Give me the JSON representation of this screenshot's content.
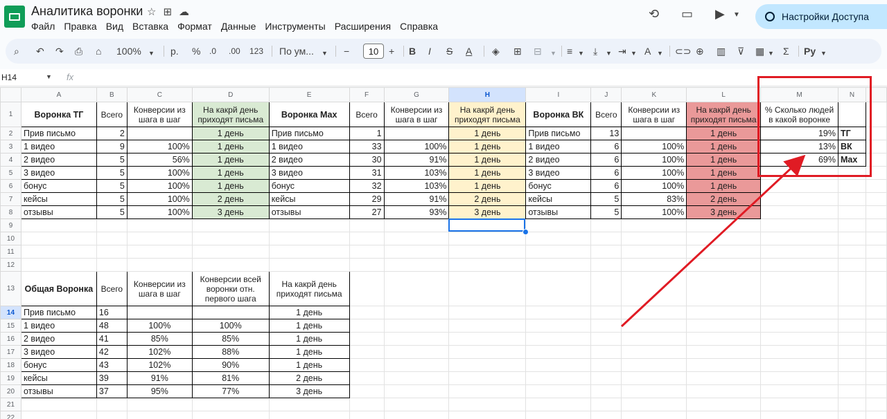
{
  "app": {
    "title": "Аналитика воронки",
    "menu": [
      "Файл",
      "Правка",
      "Вид",
      "Вставка",
      "Формат",
      "Данные",
      "Инструменты",
      "Расширения",
      "Справка"
    ],
    "share_label": "Настройки Доступа"
  },
  "toolbar": {
    "zoom": "100%",
    "currency": "р.",
    "percent": "%",
    "dec_minus": ".0",
    "dec_plus": ".00",
    "num_format": "123",
    "font": "По ум...",
    "font_size": "10"
  },
  "formula_bar": {
    "cell_ref": "H14",
    "fx": "fx",
    "value": ""
  },
  "sheet": {
    "columns": [
      "A",
      "B",
      "C",
      "D",
      "E",
      "F",
      "G",
      "H",
      "I",
      "J",
      "K",
      "L",
      "M",
      "N"
    ],
    "rows": [
      [
        "Воронка ТГ",
        "Всего",
        "Конверсии из шага в шаг",
        "На какрй день приходят письма",
        "Воронка Мах",
        "Всего",
        "Конверсии из шага в шаг",
        "На какрй день приходят письма",
        "Воронка ВК",
        "Всего",
        "Конверсии из шага в шаг",
        "На какрй день приходят письма",
        "% Сколько людей в какой воронке",
        ""
      ],
      [
        "Прив письмо",
        "2",
        "",
        "1 день",
        "Прив письмо",
        "1",
        "",
        "1 день",
        "Прив письмо",
        "13",
        "",
        "1 день",
        "19%",
        "ТГ"
      ],
      [
        "1 видео",
        "9",
        "100%",
        "1 день",
        "1 видео",
        "33",
        "100%",
        "1 день",
        "1 видео",
        "6",
        "100%",
        "1 день",
        "13%",
        "ВК"
      ],
      [
        "2 видео",
        "5",
        "56%",
        "1 день",
        "2 видео",
        "30",
        "91%",
        "1 день",
        "2 видео",
        "6",
        "100%",
        "1 день",
        "69%",
        "Max"
      ],
      [
        "3 видео",
        "5",
        "100%",
        "1 день",
        "3 видео",
        "31",
        "103%",
        "1 день",
        "3 видео",
        "6",
        "100%",
        "1 день",
        "",
        ""
      ],
      [
        "бонус",
        "5",
        "100%",
        "1 день",
        "бонус",
        "32",
        "103%",
        "1 день",
        "бонус",
        "6",
        "100%",
        "1 день",
        "",
        ""
      ],
      [
        "кейсы",
        "5",
        "100%",
        "2 день",
        "кейсы",
        "29",
        "91%",
        "2 день",
        "кейсы",
        "5",
        "83%",
        "2 день",
        "",
        ""
      ],
      [
        "отзывы",
        "5",
        "100%",
        "3 день",
        "отзывы",
        "27",
        "93%",
        "3 день",
        "отзывы",
        "5",
        "100%",
        "3 день",
        "",
        ""
      ],
      [
        "",
        "",
        "",
        "",
        "",
        "",
        "",
        "",
        "",
        "",
        "",
        "",
        "",
        ""
      ],
      [
        "",
        "",
        "",
        "",
        "",
        "",
        "",
        "",
        "",
        "",
        "",
        "",
        "",
        ""
      ],
      [
        "",
        "",
        "",
        "",
        "",
        "",
        "",
        "",
        "",
        "",
        "",
        "",
        "",
        ""
      ],
      [
        "",
        "",
        "",
        "",
        "",
        "",
        "",
        "",
        "",
        "",
        "",
        "",
        "",
        ""
      ],
      [
        "Общая Воронка",
        "Всего",
        "Конверсии из шага в шаг",
        "Конверсии всей воронки отн. первого шага",
        "На какрй день приходят письма",
        "",
        "",
        "",
        "",
        "",
        "",
        "",
        "",
        ""
      ],
      [
        "Прив письмо",
        "16",
        "",
        "",
        "1 день",
        "",
        "",
        "",
        "",
        "",
        "",
        "",
        "",
        ""
      ],
      [
        "1 видео",
        "48",
        "100%",
        "100%",
        "1 день",
        "",
        "",
        "",
        "",
        "",
        "",
        "",
        "",
        ""
      ],
      [
        "2 видео",
        "41",
        "85%",
        "85%",
        "1 день",
        "",
        "",
        "",
        "",
        "",
        "",
        "",
        "",
        ""
      ],
      [
        "3 видео",
        "42",
        "102%",
        "88%",
        "1 день",
        "",
        "",
        "",
        "",
        "",
        "",
        "",
        "",
        ""
      ],
      [
        "бонус",
        "43",
        "102%",
        "90%",
        "1 день",
        "",
        "",
        "",
        "",
        "",
        "",
        "",
        "",
        ""
      ],
      [
        "кейсы",
        "39",
        "91%",
        "81%",
        "2 день",
        "",
        "",
        "",
        "",
        "",
        "",
        "",
        "",
        ""
      ],
      [
        "отзывы",
        "37",
        "95%",
        "77%",
        "3 день",
        "",
        "",
        "",
        "",
        "",
        "",
        "",
        "",
        ""
      ],
      [
        "",
        "",
        "",
        "",
        "",
        "",
        "",
        "",
        "",
        "",
        "",
        "",
        "",
        ""
      ],
      [
        "",
        "",
        "",
        "",
        "",
        "",
        "",
        "",
        "",
        "",
        "",
        "",
        "",
        ""
      ]
    ]
  },
  "colors": {
    "green": "#d9ead3",
    "yellow": "#fff2cc",
    "red": "#ea9999",
    "annotation": "#e01b24",
    "selection": "#1a73e8"
  }
}
